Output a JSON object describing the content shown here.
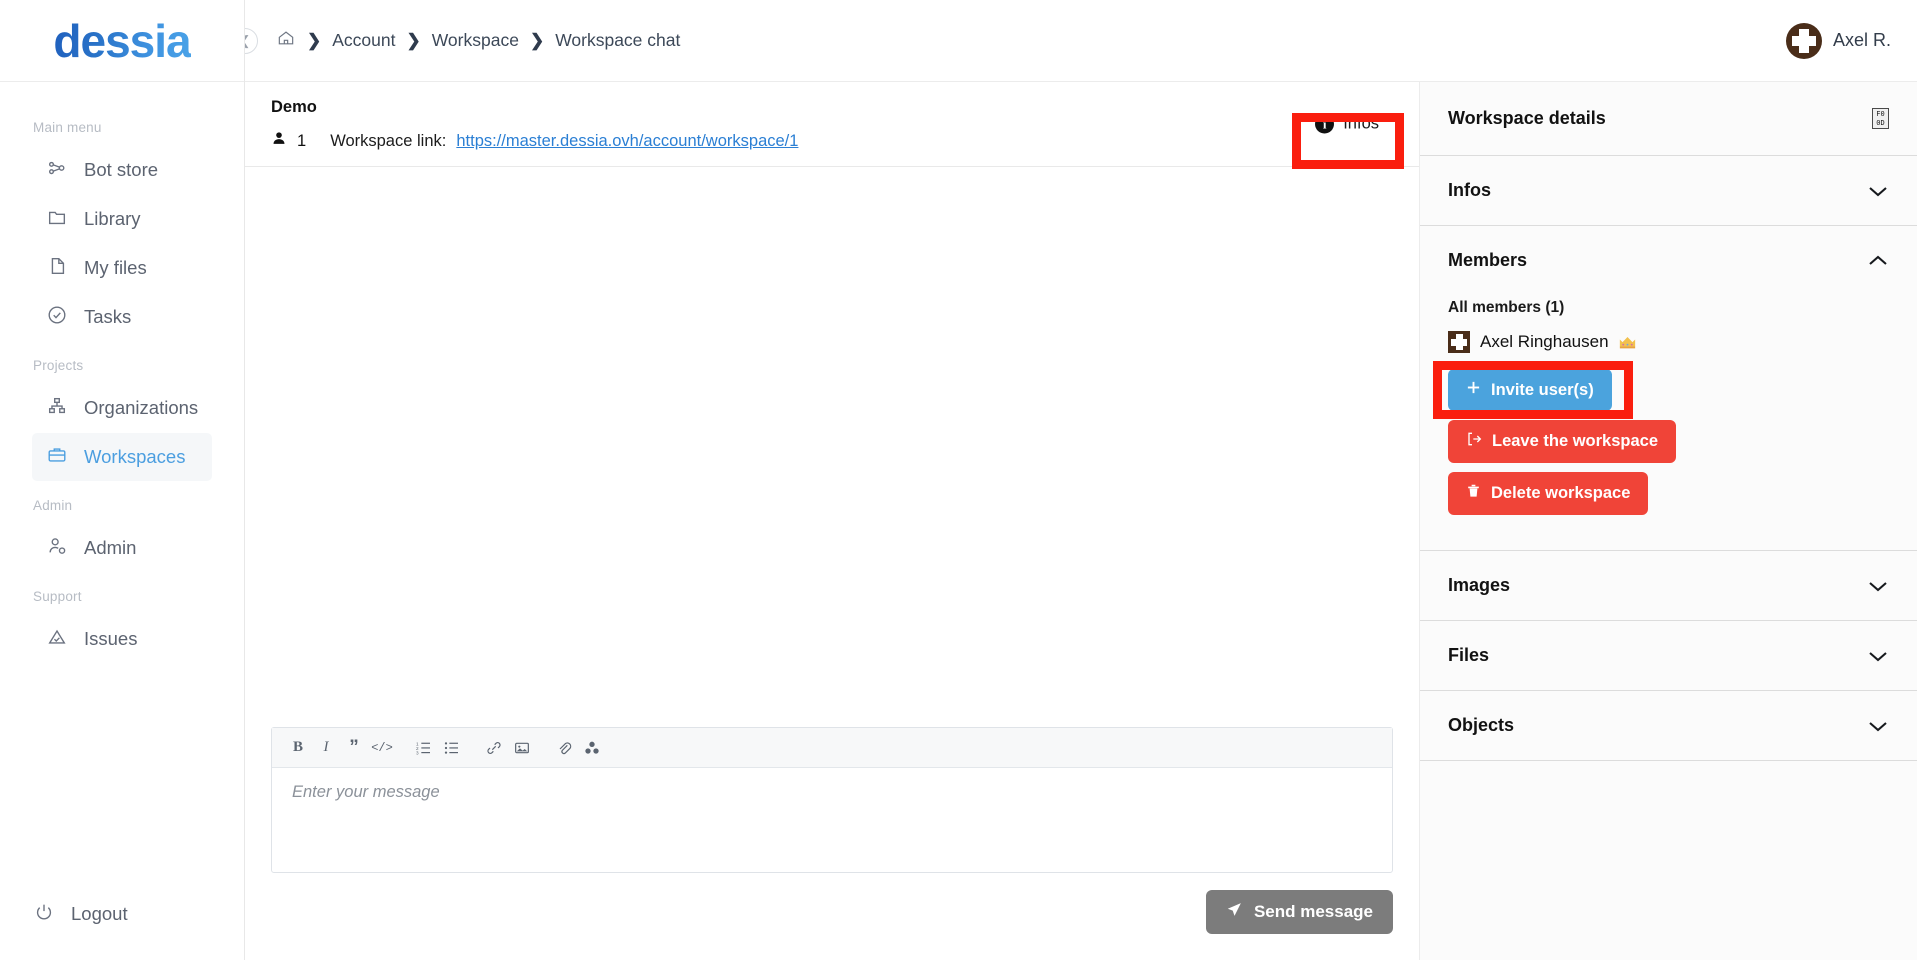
{
  "brand": {
    "logo_text": "dessia"
  },
  "sidebar": {
    "groups": [
      {
        "label": "Main menu",
        "items": [
          {
            "label": "Bot store",
            "icon": "bot-store-icon",
            "active": false
          },
          {
            "label": "Library",
            "icon": "folder-icon",
            "active": false
          },
          {
            "label": "My files",
            "icon": "file-icon",
            "active": false
          },
          {
            "label": "Tasks",
            "icon": "check-circle-icon",
            "active": false
          }
        ]
      },
      {
        "label": "Projects",
        "items": [
          {
            "label": "Organizations",
            "icon": "org-tree-icon",
            "active": false
          },
          {
            "label": "Workspaces",
            "icon": "briefcase-icon",
            "active": true
          }
        ]
      },
      {
        "label": "Admin",
        "items": [
          {
            "label": "Admin",
            "icon": "user-gear-icon",
            "active": false
          }
        ]
      },
      {
        "label": "Support",
        "items": [
          {
            "label": "Issues",
            "icon": "warning-triangle-icon",
            "active": false
          }
        ]
      }
    ],
    "logout": {
      "label": "Logout",
      "icon": "power-icon"
    }
  },
  "topbar": {
    "collapse_icon": "chevron-left-icon",
    "breadcrumb": [
      {
        "label": "",
        "icon": "home-icon"
      },
      {
        "label": "Account"
      },
      {
        "label": "Workspace"
      },
      {
        "label": "Workspace chat"
      }
    ],
    "separator": "❯",
    "user": {
      "name": "Axel R.",
      "avatar": "user-avatar"
    }
  },
  "workspace": {
    "title": "Demo",
    "member_icon": "person-icon",
    "member_count": "1",
    "link_label": "Workspace link:",
    "link_url": "https://master.dessia.ovh/account/workspace/1",
    "infos_button": {
      "label": "Infos",
      "icon": "info-circle-icon"
    }
  },
  "composer": {
    "toolbar": [
      {
        "name": "bold-icon",
        "glyph": "B"
      },
      {
        "name": "italic-icon",
        "glyph": "I"
      },
      {
        "name": "quote-icon",
        "glyph": "”"
      },
      {
        "name": "code-icon",
        "glyph": "</>"
      },
      {
        "name": "ordered-list-icon",
        "glyph": ""
      },
      {
        "name": "bullet-list-icon",
        "glyph": ""
      },
      {
        "name": "link-icon",
        "glyph": ""
      },
      {
        "name": "image-icon",
        "glyph": ""
      },
      {
        "name": "attachment-icon",
        "glyph": ""
      },
      {
        "name": "object-icon",
        "glyph": ""
      }
    ],
    "placeholder": "Enter your message",
    "send_button": {
      "label": "Send message",
      "icon": "send-plane-icon"
    }
  },
  "details": {
    "header": {
      "title": "Workspace details",
      "close_icon_glyph": "F0\n0D"
    },
    "sections": [
      {
        "id": "infos",
        "title": "Infos",
        "expanded": false,
        "chevron": "chevron-down-icon"
      },
      {
        "id": "members",
        "title": "Members",
        "expanded": true,
        "chevron": "chevron-up-icon"
      },
      {
        "id": "images",
        "title": "Images",
        "expanded": false,
        "chevron": "chevron-down-icon"
      },
      {
        "id": "files",
        "title": "Files",
        "expanded": false,
        "chevron": "chevron-down-icon"
      },
      {
        "id": "objects",
        "title": "Objects",
        "expanded": false,
        "chevron": "chevron-down-icon"
      }
    ],
    "members": {
      "all_members_label": "All members (1)",
      "list": [
        {
          "name": "Axel Ringhausen",
          "badge": "crown-icon",
          "avatar": "user-avatar"
        }
      ],
      "actions": [
        {
          "id": "invite",
          "label": "Invite user(s)",
          "icon": "plus-icon",
          "style": "primary"
        },
        {
          "id": "leave",
          "label": "Leave the workspace",
          "icon": "logout-icon",
          "style": "danger"
        },
        {
          "id": "delete",
          "label": "Delete workspace",
          "icon": "trash-icon",
          "style": "danger"
        }
      ]
    }
  },
  "colors": {
    "accent_blue": "#4ba3dd",
    "danger_red": "#f04438",
    "highlight_red": "#fa1e0e",
    "link_blue": "#2b7fd4",
    "disabled_grey": "#7c7c7c"
  }
}
